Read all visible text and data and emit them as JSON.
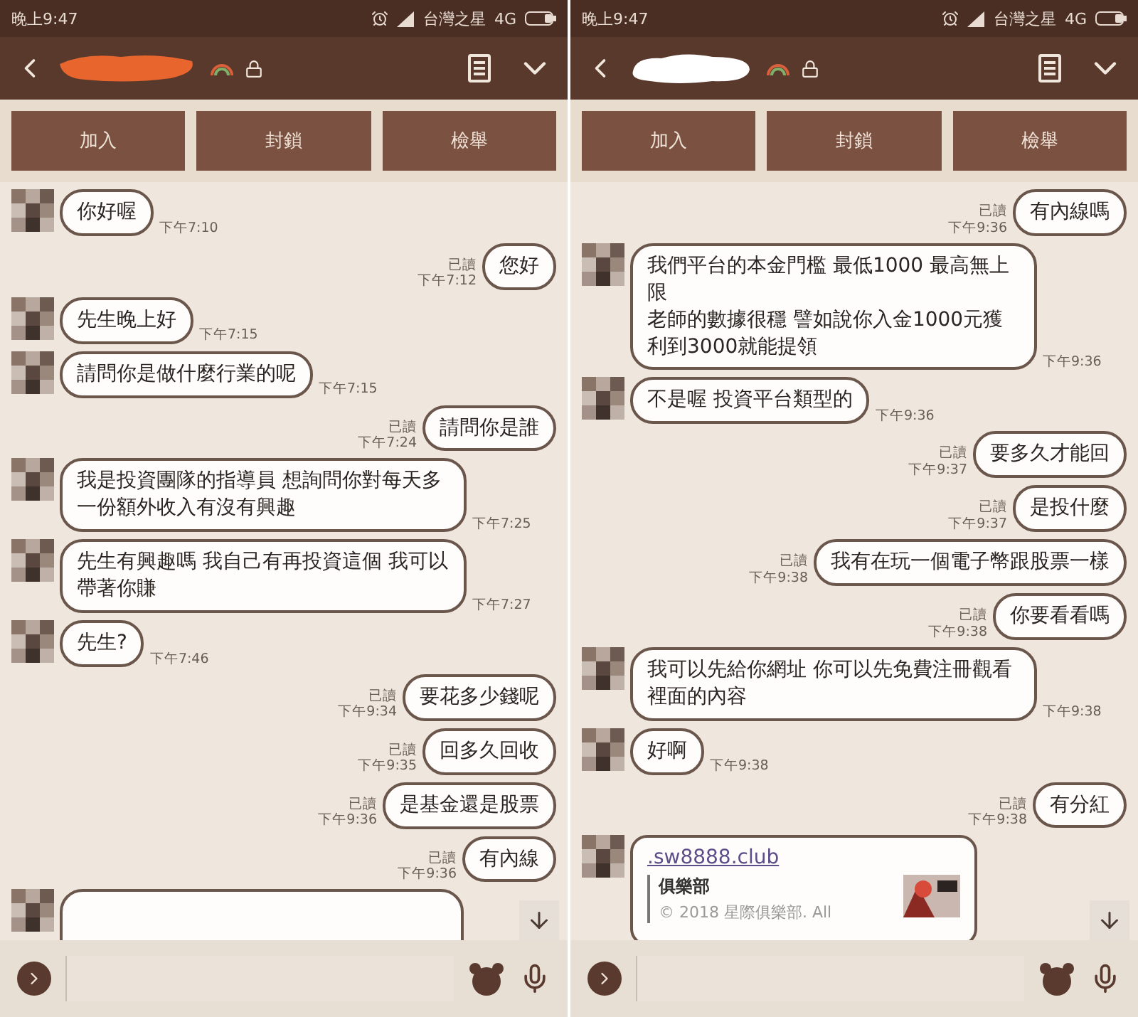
{
  "phones": [
    {
      "status_bar": {
        "time": "晚上9:47",
        "carrier": "台灣之星",
        "network": "4G"
      },
      "header": {
        "redaction": {
          "kind": "scribble"
        }
      },
      "actions": [
        "加入",
        "封鎖",
        "檢舉"
      ],
      "messages": [
        {
          "kind": "incoming",
          "text": "你好喔",
          "time": "下午7:10"
        },
        {
          "kind": "outgoing",
          "text": "您好",
          "read": "已讀",
          "time": "下午7:12"
        },
        {
          "kind": "incoming",
          "text": "先生晚上好",
          "time": "下午7:15"
        },
        {
          "kind": "incoming",
          "text": "請問你是做什麼行業的呢",
          "time": "下午7:15"
        },
        {
          "kind": "outgoing",
          "text": "請問你是誰",
          "read": "已讀",
          "time": "下午7:24"
        },
        {
          "kind": "incoming",
          "text": "我是投資團隊的指導員 想詢問你對每天多一份額外收入有沒有興趣",
          "time": "下午7:25"
        },
        {
          "kind": "incoming",
          "text": "先生有興趣嗎 我自己有再投資這個 我可以帶著你賺",
          "time": "下午7:27"
        },
        {
          "kind": "incoming",
          "text": "先生?",
          "time": "下午7:46"
        },
        {
          "kind": "outgoing",
          "text": "要花多少錢呢",
          "read": "已讀",
          "time": "下午9:34"
        },
        {
          "kind": "outgoing",
          "text": "回多久回收",
          "read": "已讀",
          "time": "下午9:35"
        },
        {
          "kind": "outgoing",
          "text": "是基金還是股票",
          "read": "已讀",
          "time": "下午9:36"
        },
        {
          "kind": "outgoing",
          "text": "有內線",
          "read": "已讀",
          "time": "下午9:36"
        },
        {
          "kind": "partial"
        }
      ]
    },
    {
      "status_bar": {
        "time": "晚上9:47",
        "carrier": "台灣之星",
        "network": "4G"
      },
      "header": {
        "redaction": {
          "kind": "cloud"
        }
      },
      "actions": [
        "加入",
        "封鎖",
        "檢舉"
      ],
      "messages": [
        {
          "kind": "outgoing",
          "text": "有內線嗎",
          "read": "已讀",
          "time": "下午9:36"
        },
        {
          "kind": "incoming",
          "lines": [
            "我們平台的本金門檻 最低1000 最高無上限",
            "老師的數據很穩 譬如說你入金1000元獲利到3000就能提領"
          ],
          "time": "下午9:36"
        },
        {
          "kind": "incoming",
          "text": "不是喔 投資平台類型的",
          "time": "下午9:36"
        },
        {
          "kind": "outgoing",
          "text": "要多久才能回",
          "read": "已讀",
          "time": "下午9:37"
        },
        {
          "kind": "outgoing",
          "text": "是投什麼",
          "read": "已讀",
          "time": "下午9:37"
        },
        {
          "kind": "outgoing",
          "text": "我有在玩一個電子幣跟股票一樣",
          "read": "已讀",
          "time": "下午9:38"
        },
        {
          "kind": "outgoing",
          "text": "你要看看嗎",
          "read": "已讀",
          "time": "下午9:38"
        },
        {
          "kind": "incoming",
          "text": "我可以先給你網址 你可以先免費注冊觀看裡面的內容",
          "time": "下午9:38"
        },
        {
          "kind": "incoming",
          "text": "好啊",
          "time": "下午9:38"
        },
        {
          "kind": "outgoing",
          "text": "有分紅",
          "read": "已讀",
          "time": "下午9:38"
        },
        {
          "kind": "link",
          "url": ".sw8888.club",
          "title": "俱樂部",
          "footer": "© 2018 星際俱樂部. All"
        }
      ]
    }
  ]
}
